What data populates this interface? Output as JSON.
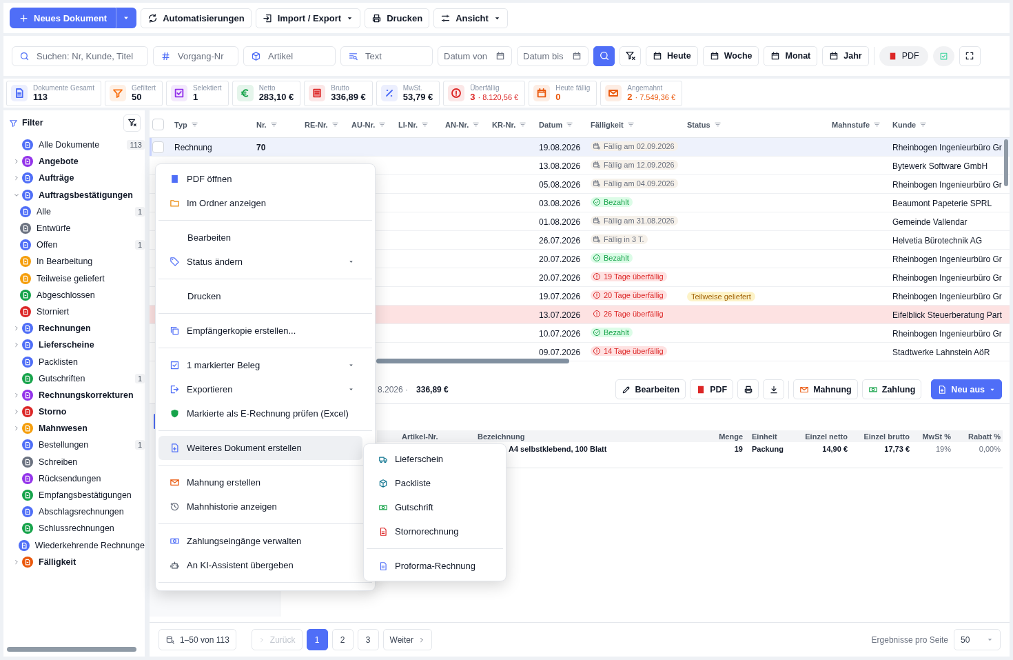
{
  "toolbar": {
    "new_document": "Neues Dokument",
    "buttons": [
      {
        "label": "Automatisierungen",
        "dropdown": false
      },
      {
        "label": "Import / Export",
        "dropdown": true
      },
      {
        "label": "Drucken",
        "dropdown": false
      },
      {
        "label": "Ansicht",
        "dropdown": true
      }
    ]
  },
  "filters": {
    "fields": [
      {
        "placeholder": "Suchen: Nr, Kunde, Titel"
      },
      {
        "placeholder": "Vorgang-Nr"
      },
      {
        "placeholder": "Artikel"
      },
      {
        "placeholder": "Text"
      }
    ],
    "dates": [
      {
        "placeholder": "Datum von"
      },
      {
        "placeholder": "Datum bis"
      }
    ],
    "periods": [
      "Heute",
      "Woche",
      "Monat",
      "Jahr"
    ],
    "pdf": "PDF"
  },
  "stats": [
    {
      "label": "Dokumente Gesamt",
      "value": "113",
      "color": "#4f6ef7",
      "highlight": false
    },
    {
      "label": "Gefiltert",
      "value": "50",
      "color": "#f97316",
      "highlight": false
    },
    {
      "label": "Selektiert",
      "value": "1",
      "color": "#9333ea",
      "highlight": false
    },
    {
      "label": "Netto",
      "value": "283,10 €",
      "color": "#16a34a",
      "highlight": false
    },
    {
      "label": "Brutto",
      "value": "336,89 €",
      "color": "#dc2626",
      "highlight": false
    },
    {
      "label": "MwSt.",
      "value": "53,79 €",
      "color": "#4f6ef7",
      "highlight": false
    },
    {
      "label": "Überfällig",
      "value": "3",
      "extra": "· 8.120,56 €",
      "color": "#dc2626",
      "highlight": true
    },
    {
      "label": "Heute fällig",
      "value": "0",
      "color": "#ea580c",
      "highlight": true
    },
    {
      "label": "Angemahnt",
      "value": "2",
      "extra": "· 7.549,36 €",
      "color": "#ea580c",
      "highlight": true
    }
  ],
  "sidebar": {
    "title": "Filter",
    "items": [
      {
        "label": "Alle Dokumente",
        "color": "#4f6ef7",
        "count": "113"
      },
      {
        "label": "Angebote",
        "color": "#9333ea",
        "expanded": false
      },
      {
        "label": "Aufträge",
        "color": "#4f6ef7",
        "expanded": false
      },
      {
        "label": "Auftragsbestätigungen",
        "color": "#4f6ef7",
        "expanded": true,
        "children": [
          {
            "label": "Alle",
            "color": "#4f6ef7",
            "count": "1"
          },
          {
            "label": "Entwürfe",
            "color": "#6b7280"
          },
          {
            "label": "Offen",
            "color": "#4f6ef7",
            "count": "1"
          },
          {
            "label": "In Bearbeitung",
            "color": "#f59e0b"
          },
          {
            "label": "Teilweise geliefert",
            "color": "#f59e0b"
          },
          {
            "label": "Abgeschlossen",
            "color": "#16a34a"
          },
          {
            "label": "Storniert",
            "color": "#dc2626"
          }
        ]
      },
      {
        "label": "Rechnungen",
        "color": "#4f6ef7",
        "expanded": false
      },
      {
        "label": "Lieferscheine",
        "color": "#4f6ef7",
        "expanded": false
      },
      {
        "label": "Packlisten",
        "color": "#4f6ef7"
      },
      {
        "label": "Gutschriften",
        "color": "#16a34a",
        "count": "1"
      },
      {
        "label": "Rechnungskorrekturen",
        "color": "#9333ea",
        "expanded": false
      },
      {
        "label": "Storno",
        "color": "#dc2626",
        "expanded": false
      },
      {
        "label": "Mahnwesen",
        "color": "#f59e0b",
        "expanded": false
      },
      {
        "label": "Bestellungen",
        "color": "#4f6ef7",
        "count": "1"
      },
      {
        "label": "Schreiben",
        "color": "#6b7280"
      },
      {
        "label": "Rücksendungen",
        "color": "#9333ea"
      },
      {
        "label": "Empfangsbestätigungen",
        "color": "#16a34a"
      },
      {
        "label": "Abschlagsrechnungen",
        "color": "#4f6ef7"
      },
      {
        "label": "Schlussrechnungen",
        "color": "#16a34a"
      },
      {
        "label": "Wiederkehrende Rechnunge",
        "color": "#4f6ef7"
      },
      {
        "label": "Fälligkeit",
        "color": "#ea580c",
        "expanded": false
      }
    ]
  },
  "table": {
    "select_all": false,
    "columns": [
      "Typ",
      "Nr.",
      "RE-Nr.",
      "AU-Nr.",
      "LI-Nr.",
      "AN-Nr.",
      "KR-Nr.",
      "Datum",
      "Fälligkeit",
      "Status",
      "Mahnstufe",
      "Kunde"
    ],
    "rows": [
      {
        "checked": false,
        "selected": true,
        "flagged": false,
        "typ": "Rechnung",
        "nr": "70",
        "datum": "19.08.2026",
        "due": {
          "kind": "due",
          "text": "Fällig am 02.09.2026"
        },
        "kunde": "Rheinbogen Ingenieurbüro Gr"
      },
      {
        "selected": false,
        "flagged": false,
        "datum": "13.08.2026",
        "due": {
          "kind": "due",
          "text": "Fällig am 12.09.2026"
        },
        "kunde": "Bytewerk Software GmbH"
      },
      {
        "selected": false,
        "flagged": false,
        "datum": "05.08.2026",
        "due": {
          "kind": "due",
          "text": "Fällig am 04.09.2026"
        },
        "kunde": "Rheinbogen Ingenieurbüro Gr"
      },
      {
        "selected": false,
        "flagged": false,
        "datum": "03.08.2026",
        "due": {
          "kind": "paid",
          "text": "Bezahlt"
        },
        "kunde": "Beaumont Papeterie SPRL"
      },
      {
        "selected": false,
        "flagged": false,
        "datum": "01.08.2026",
        "due": {
          "kind": "due",
          "text": "Fällig am 31.08.2026"
        },
        "kunde": "Gemeinde Vallendar"
      },
      {
        "selected": false,
        "flagged": false,
        "datum": "26.07.2026",
        "due": {
          "kind": "due",
          "text": "Fällig in 3 T."
        },
        "kunde": "Helvetia Bürotechnik AG"
      },
      {
        "selected": false,
        "flagged": false,
        "datum": "20.07.2026",
        "due": {
          "kind": "paid",
          "text": "Bezahlt"
        },
        "kunde": "Rheinbogen Ingenieurbüro Gr"
      },
      {
        "selected": false,
        "flagged": false,
        "datum": "20.07.2026",
        "due": {
          "kind": "overdue",
          "text": "19 Tage überfällig"
        },
        "kunde": "Rheinbogen Ingenieurbüro Gr"
      },
      {
        "selected": false,
        "flagged": false,
        "datum": "19.07.2026",
        "due": {
          "kind": "overdue",
          "text": "20 Tage überfällig"
        },
        "status": "Teilweise geliefert",
        "kunde": "Rheinbogen Ingenieurbüro Gr"
      },
      {
        "selected": false,
        "flagged": true,
        "datum": "13.07.2026",
        "due": {
          "kind": "overdue",
          "text": "26 Tage überfällig"
        },
        "kunde": "Eifelblick Steuerberatung Part"
      },
      {
        "selected": false,
        "flagged": false,
        "datum": "10.07.2026",
        "due": {
          "kind": "paid",
          "text": "Bezahlt"
        },
        "kunde": "Rheinbogen Ingenieurbüro Gr"
      },
      {
        "selected": false,
        "flagged": false,
        "datum": "09.07.2026",
        "due": {
          "kind": "overdue",
          "text": "14 Tage überfällig"
        },
        "kunde": "Stadtwerke Lahnstein AöR"
      }
    ]
  },
  "context_menu": {
    "sections": [
      [
        {
          "label": "PDF öffnen",
          "has_submenu": false,
          "highlighted": false
        },
        {
          "label": "Im Ordner anzeigen",
          "has_submenu": false,
          "highlighted": false
        }
      ],
      [
        {
          "label": "Bearbeiten",
          "has_submenu": false,
          "highlighted": false
        },
        {
          "label": "Status ändern",
          "has_submenu": true,
          "highlighted": false
        }
      ],
      [
        {
          "label": "Drucken",
          "has_submenu": false,
          "highlighted": false
        }
      ],
      [
        {
          "label": "Empfängerkopie erstellen...",
          "has_submenu": false,
          "highlighted": false
        }
      ],
      [
        {
          "label": "1 markierter Beleg",
          "has_submenu": true,
          "highlighted": false
        },
        {
          "label": "Exportieren",
          "has_submenu": true,
          "highlighted": false
        },
        {
          "label": "Markierte als E-Rechnung prüfen (Excel)",
          "has_submenu": false,
          "highlighted": false
        }
      ],
      [
        {
          "label": "Weiteres Dokument erstellen",
          "has_submenu": false,
          "highlighted": true
        }
      ],
      [
        {
          "label": "Mahnung erstellen",
          "has_submenu": false,
          "highlighted": false
        },
        {
          "label": "Mahnhistorie anzeigen",
          "has_submenu": false,
          "highlighted": false
        }
      ],
      [
        {
          "label": "Zahlungseingänge verwalten",
          "has_submenu": false,
          "highlighted": false
        },
        {
          "label": "An KI-Assistent übergeben",
          "has_submenu": false,
          "highlighted": false
        }
      ]
    ]
  },
  "submenu": {
    "sections": [
      [
        "Lieferschein",
        "Packliste",
        "Gutschrift",
        "Stornorechnung"
      ],
      [
        "Proforma-Rechnung"
      ]
    ]
  },
  "detail": {
    "date_partial": "8.2026 ·",
    "amount": "336,89 €",
    "buttons": [
      "Bearbeiten",
      "PDF",
      "Mahnung",
      "Zahlung"
    ],
    "new_from": "Neu aus"
  },
  "items": {
    "columns": [
      "Artikel-Nr.",
      "Bezeichnung",
      "Menge",
      "Einheit",
      "Einzel netto",
      "Einzel brutto",
      "MwSt %",
      "Rabatt %"
    ],
    "rows": [
      {
        "bezeichnung": "A4 selbstklebend, 100 Blatt",
        "menge": "19",
        "einheit": "Packung",
        "netto": "14,90 €",
        "brutto": "17,73 €",
        "mwst": "19%",
        "rabatt": "0,00%"
      }
    ]
  },
  "pagination": {
    "range": "1–50 von 113",
    "prev": "Zurück",
    "prev_disabled": true,
    "pages": [
      {
        "label": "1",
        "selected": true
      },
      {
        "label": "2",
        "selected": false
      },
      {
        "label": "3",
        "selected": false
      }
    ],
    "next": "Weiter",
    "per_page_label": "Ergebnisse pro Seite",
    "per_page": "50"
  }
}
